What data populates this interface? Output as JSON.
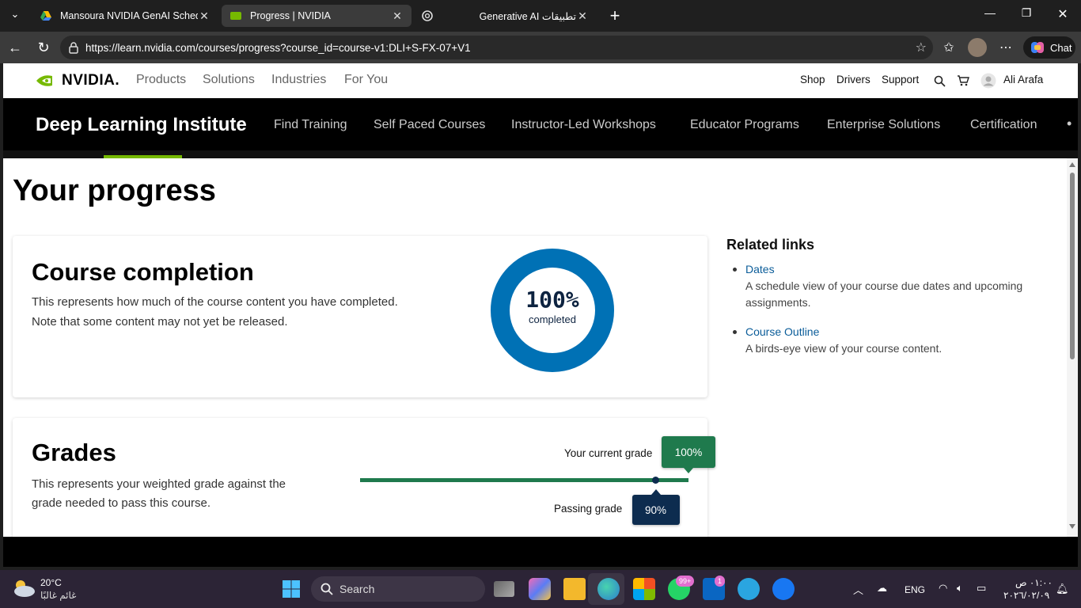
{
  "browser": {
    "tabs": [
      {
        "title": "Mansoura NVIDIA GenAI Schedule",
        "active": false
      },
      {
        "title": "Progress | NVIDIA",
        "active": true
      },
      {
        "title": "Generative AI تطبيقات",
        "active": false
      }
    ],
    "url": "https://learn.nvidia.com/courses/progress?course_id=course-v1:DLI+S-FX-07+V1",
    "chat_label": "Chat"
  },
  "topnav": {
    "logo": "NVIDIA.",
    "left_links": [
      "Products",
      "Solutions",
      "Industries",
      "For You"
    ],
    "right_links": [
      "Shop",
      "Drivers",
      "Support"
    ],
    "user": "Ali Arafa"
  },
  "dli": {
    "title": "Deep Learning Institute",
    "links": [
      "Find Training",
      "Self Paced Courses",
      "Instructor-Led Workshops",
      "Educator Programs",
      "Enterprise Solutions",
      "Certification"
    ]
  },
  "page": {
    "title": "Your progress",
    "completion": {
      "heading": "Course completion",
      "desc_line1": "This represents how much of the course content you have completed.",
      "desc_line2": "Note that some content may not yet be released.",
      "percent_text": "100%",
      "percent_value": 100,
      "sub": "completed",
      "ring_color": "#0071b5"
    },
    "grades": {
      "heading": "Grades",
      "desc_line1": "This represents your weighted grade against the",
      "desc_line2": "grade needed to pass this course.",
      "current_label": "Your current grade",
      "current_value": "100%",
      "current_fraction": 1.0,
      "passing_label": "Passing grade",
      "passing_value": "90%",
      "passing_fraction": 0.9,
      "bar_color": "#1f7a4d",
      "passing_color": "#0d2c4f"
    },
    "related": {
      "heading": "Related links",
      "items": [
        {
          "link": "Dates",
          "desc_line1": "A schedule view of your course due dates and upcoming",
          "desc_line2": "assignments."
        },
        {
          "link": "Course Outline",
          "desc_line1": "A birds-eye view of your course content.",
          "desc_line2": ""
        }
      ]
    }
  },
  "taskbar": {
    "weather_temp": "20°C",
    "weather_desc": "غائم غالبًا",
    "search_label": "Search",
    "lang": "ENG",
    "time": "٠١:٠٠ ص",
    "date": "٢٠٢٦/٠٢/٠٩",
    "whatsapp_badge": "99+",
    "linkedin_badge": "1"
  }
}
